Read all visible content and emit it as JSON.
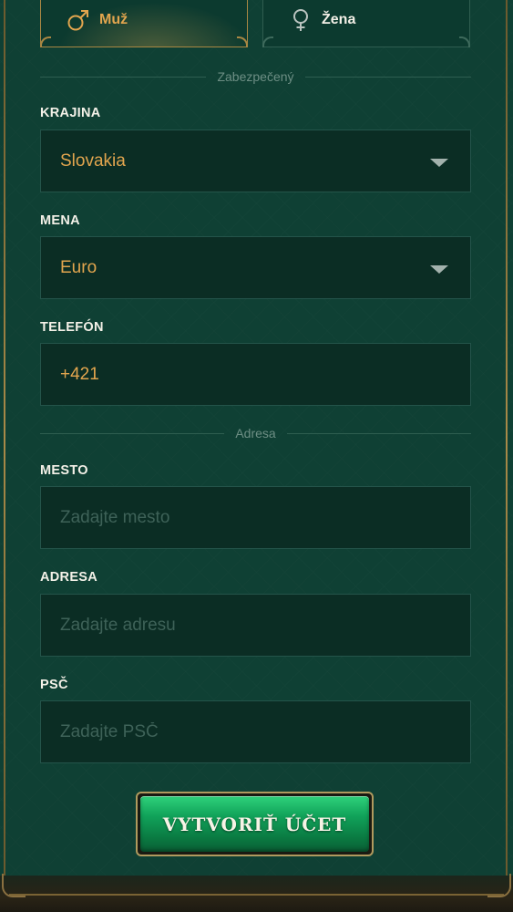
{
  "gender": {
    "male": {
      "label": "Muž",
      "icon": "male-symbol-icon",
      "selected": true
    },
    "female": {
      "label": "Žena",
      "icon": "female-symbol-icon",
      "selected": false
    }
  },
  "sections": {
    "secure": "Zabezpečený",
    "address": "Adresa"
  },
  "fields": {
    "country": {
      "label": "KRAJINA",
      "value": "Slovakia"
    },
    "currency": {
      "label": "MENA",
      "value": "Euro"
    },
    "phone": {
      "label": "TELEFÓN",
      "value": "+421"
    },
    "city": {
      "label": "MESTO",
      "placeholder": "Zadajte mesto"
    },
    "address": {
      "label": "ADRESA",
      "placeholder": "Zadajte adresu"
    },
    "zip": {
      "label": "PSČ",
      "placeholder": "Zadajte PSČ"
    }
  },
  "submit_label": "VYTVORIŤ ÚČET",
  "colors": {
    "accent_gold": "#e2a54e",
    "panel_green": "#0f4034",
    "button_green": "#11a35a"
  }
}
